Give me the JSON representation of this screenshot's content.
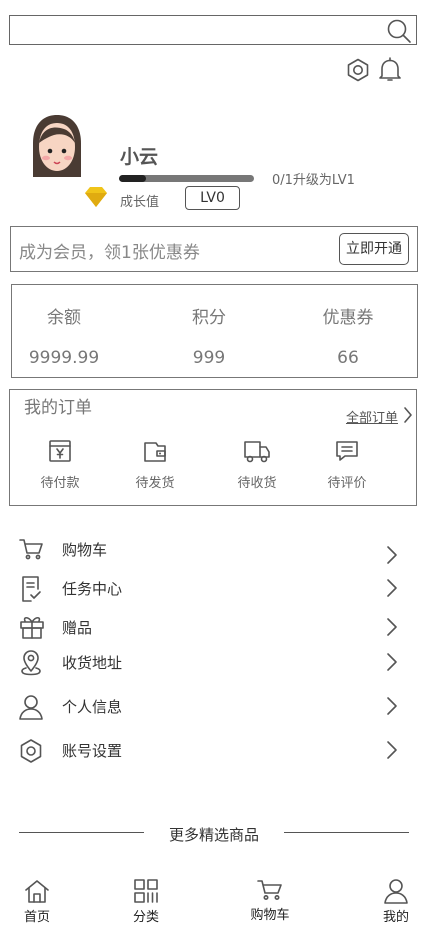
{
  "search": {
    "placeholder": "",
    "button_icon": "search-icon"
  },
  "header": {
    "icons": [
      "settings-hex-icon",
      "bell-icon"
    ]
  },
  "profile": {
    "name": "小云",
    "growth_label": "成长值",
    "level": "LV0",
    "progress_text": "0/1升级为LV1",
    "progress_fraction": 0.2,
    "badge_color": "#f0c419"
  },
  "member": {
    "text": "成为会员，领1张优惠券",
    "button": "立即开通"
  },
  "stats": [
    {
      "label": "余额",
      "value": "9999.99"
    },
    {
      "label": "积分",
      "value": "999"
    },
    {
      "label": "优惠券",
      "value": "66"
    }
  ],
  "orders": {
    "title": "我的订单",
    "all_link": "全部订单",
    "items": [
      {
        "label": "待付款",
        "icon": "wallet-yen-icon"
      },
      {
        "label": "待发货",
        "icon": "wallet-icon"
      },
      {
        "label": "待收货",
        "icon": "truck-icon"
      },
      {
        "label": "待评价",
        "icon": "comment-icon"
      }
    ]
  },
  "menu": [
    {
      "label": "购物车",
      "icon": "cart-icon"
    },
    {
      "label": "任务中心",
      "icon": "task-icon"
    },
    {
      "label": "赠品",
      "icon": "gift-icon"
    },
    {
      "label": "收货地址",
      "icon": "location-icon"
    },
    {
      "label": "个人信息",
      "icon": "user-icon"
    },
    {
      "label": "账号设置",
      "icon": "settings-icon"
    }
  ],
  "more": {
    "title": "更多精选商品"
  },
  "tabbar": [
    {
      "label": "首页",
      "icon": "home-icon"
    },
    {
      "label": "分类",
      "icon": "category-icon"
    },
    {
      "label": "购物车",
      "icon": "cart-icon"
    },
    {
      "label": "我的",
      "icon": "user-icon"
    }
  ]
}
